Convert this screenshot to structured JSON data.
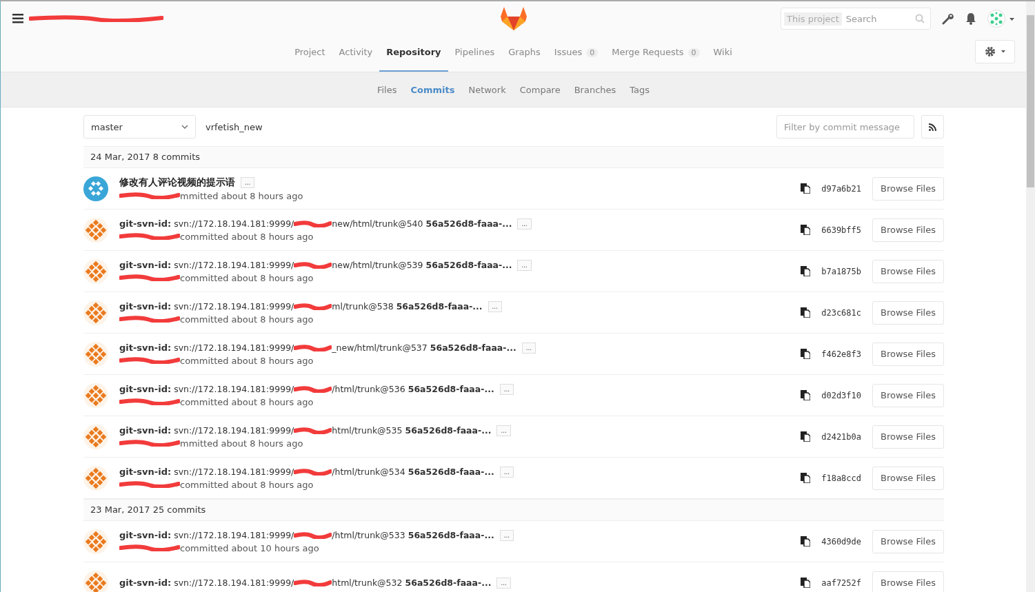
{
  "header": {
    "search": {
      "scope": "This project",
      "placeholder": "Search"
    }
  },
  "nav_tabs": [
    {
      "label": "Project",
      "selected": false
    },
    {
      "label": "Activity",
      "selected": false
    },
    {
      "label": "Repository",
      "selected": true
    },
    {
      "label": "Pipelines",
      "selected": false
    },
    {
      "label": "Graphs",
      "selected": false
    },
    {
      "label": "Issues",
      "count": "0",
      "selected": false
    },
    {
      "label": "Merge Requests",
      "count": "0",
      "selected": false
    },
    {
      "label": "Wiki",
      "selected": false
    }
  ],
  "sub_tabs": [
    {
      "label": "Files",
      "selected": false
    },
    {
      "label": "Commits",
      "selected": true
    },
    {
      "label": "Network",
      "selected": false
    },
    {
      "label": "Compare",
      "selected": false
    },
    {
      "label": "Branches",
      "selected": false
    },
    {
      "label": "Tags",
      "selected": false
    }
  ],
  "toolbar": {
    "branch": "master",
    "path": "vrfetish_new",
    "filter_placeholder": "Filter by commit message"
  },
  "groups": [
    {
      "heading": "24 Mar, 2017 8 commits",
      "commits": [
        {
          "kind": "message",
          "title": "修改有人评论视频的提示语",
          "more": "...",
          "author_tail": "mmitted about 8 hours ago",
          "sha": "d97a6b21",
          "button": "Browse Files"
        },
        {
          "kind": "svn",
          "label": "git-svn-id:",
          "path_start": "svn://172.18.194.181:9999/",
          "path_end": "new/html/trunk@540",
          "uuid": "56a526d8-faaa-...",
          "more": "...",
          "author_tail": "committed about 8 hours ago",
          "sha": "6639bff5",
          "button": "Browse Files"
        },
        {
          "kind": "svn",
          "label": "git-svn-id:",
          "path_start": "svn://172.18.194.181:9999/",
          "path_end": "new/html/trunk@539",
          "uuid": "56a526d8-faaa-...",
          "more": "...",
          "author_tail": "committed about 8 hours ago",
          "sha": "b7a1875b",
          "button": "Browse Files"
        },
        {
          "kind": "svn",
          "label": "git-svn-id:",
          "path_start": "svn://172.18.194.181:9999/",
          "path_end": "ml/trunk@538",
          "uuid": "56a526d8-faaa-...",
          "more": "...",
          "author_tail": "committed about 8 hours ago",
          "sha": "d23c681c",
          "button": "Browse Files"
        },
        {
          "kind": "svn",
          "label": "git-svn-id:",
          "path_start": "svn://172.18.194.181:9999/",
          "path_end": "_new/html/trunk@537",
          "uuid": "56a526d8-faaa-...",
          "more": "...",
          "author_tail": "committed about 8 hours ago",
          "sha": "f462e8f3",
          "button": "Browse Files"
        },
        {
          "kind": "svn",
          "label": "git-svn-id:",
          "path_start": "svn://172.18.194.181:9999/",
          "path_end": "/html/trunk@536",
          "uuid": "56a526d8-faaa-...",
          "more": "...",
          "author_tail": "committed about 8 hours ago",
          "sha": "d02d3f10",
          "button": "Browse Files"
        },
        {
          "kind": "svn",
          "label": "git-svn-id:",
          "path_start": "svn://172.18.194.181:9999/",
          "path_end": "html/trunk@535",
          "uuid": "56a526d8-faaa-...",
          "more": "...",
          "author_tail": "mmitted about 8 hours ago",
          "sha": "d2421b0a",
          "button": "Browse Files"
        },
        {
          "kind": "svn",
          "label": "git-svn-id:",
          "path_start": "svn://172.18.194.181:9999/",
          "path_end": "/html/trunk@534",
          "uuid": "56a526d8-faaa-...",
          "more": "...",
          "author_tail": "committed about 8 hours ago",
          "sha": "f18a8ccd",
          "button": "Browse Files"
        }
      ]
    },
    {
      "heading": "23 Mar, 2017 25 commits",
      "commits": [
        {
          "kind": "svn",
          "label": "git-svn-id:",
          "path_start": "svn://172.18.194.181:9999/",
          "path_end": "/html/trunk@533",
          "uuid": "56a526d8-faaa-...",
          "more": "...",
          "author_tail": "committed about 10 hours ago",
          "sha": "4360d9de",
          "button": "Browse Files"
        },
        {
          "kind": "svn",
          "label": "git-svn-id:",
          "path_start": "svn://172.18.194.181:9999/",
          "path_end": "html/trunk@532",
          "uuid": "56a526d8-faaa-...",
          "more": "...",
          "sha": "aaf7252f",
          "button": "Browse Files"
        }
      ]
    }
  ]
}
